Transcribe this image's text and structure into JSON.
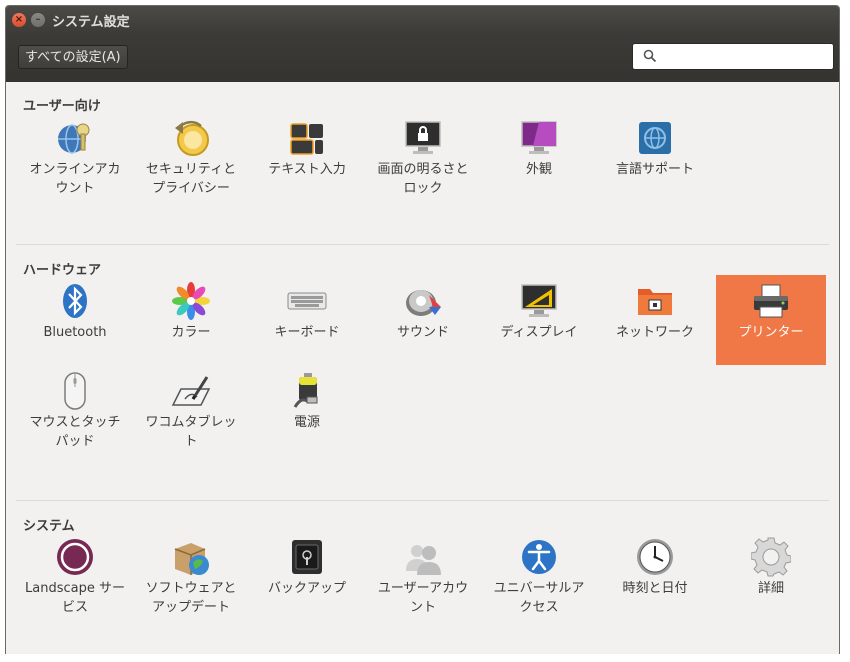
{
  "window": {
    "title": "システム設定"
  },
  "toolbar": {
    "all_settings_label": "すべての設定(A)",
    "search": {
      "value": "",
      "placeholder": ""
    }
  },
  "sections": [
    {
      "title": "ユーザー向け",
      "items": [
        {
          "label": "オンラインアカウント",
          "icon": "online-accounts-icon"
        },
        {
          "label": "セキュリティとプライバシー",
          "icon": "security-privacy-icon"
        },
        {
          "label": "テキスト入力",
          "icon": "text-entry-icon"
        },
        {
          "label": "画面の明るさとロック",
          "icon": "brightness-lock-icon"
        },
        {
          "label": "外観",
          "icon": "appearance-icon"
        },
        {
          "label": "言語サポート",
          "icon": "language-support-icon"
        }
      ]
    },
    {
      "title": "ハードウェア",
      "items": [
        {
          "label": "Bluetooth",
          "icon": "bluetooth-icon"
        },
        {
          "label": "カラー",
          "icon": "color-icon"
        },
        {
          "label": "キーボード",
          "icon": "keyboard-icon"
        },
        {
          "label": "サウンド",
          "icon": "sound-icon"
        },
        {
          "label": "ディスプレイ",
          "icon": "display-icon"
        },
        {
          "label": "ネットワーク",
          "icon": "network-icon"
        },
        {
          "label": "プリンター",
          "icon": "printer-icon",
          "selected": true
        },
        {
          "label": "マウスとタッチパッド",
          "icon": "mouse-icon"
        },
        {
          "label": "ワコムタブレット",
          "icon": "wacom-tablet-icon"
        },
        {
          "label": "電源",
          "icon": "power-icon"
        }
      ]
    },
    {
      "title": "システム",
      "items": [
        {
          "label": "Landscape サービス",
          "icon": "landscape-icon"
        },
        {
          "label": "ソフトウェアとアップデート",
          "icon": "software-updates-icon"
        },
        {
          "label": "バックアップ",
          "icon": "backup-icon"
        },
        {
          "label": "ユーザーアカウント",
          "icon": "user-accounts-icon"
        },
        {
          "label": "ユニバーサルアクセス",
          "icon": "universal-access-icon"
        },
        {
          "label": "時刻と日付",
          "icon": "clock-icon"
        },
        {
          "label": "詳細",
          "icon": "details-gear-icon"
        }
      ]
    }
  ],
  "colors": {
    "selection": "#f07746",
    "background": "#f2f1f0",
    "titlebar": "#3c3b37"
  }
}
